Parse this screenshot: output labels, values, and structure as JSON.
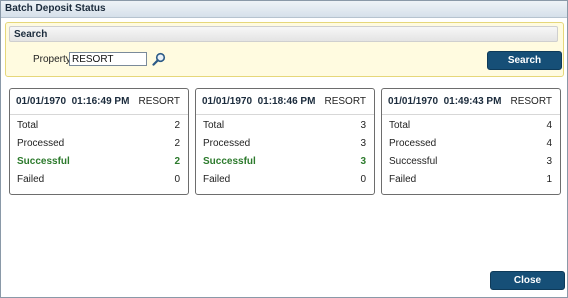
{
  "window": {
    "title": "Batch Deposit Status"
  },
  "search": {
    "header": "Search",
    "property_label": "Property",
    "property_value": "RESORT",
    "lookup_icon": "magnifier-icon",
    "button_label": "Search"
  },
  "cards": [
    {
      "timestamp": "01/01/1970  01:16:49 PM",
      "property": "RESORT",
      "rows": [
        {
          "label": "Total",
          "value": "2",
          "highlight": false
        },
        {
          "label": "Processed",
          "value": "2",
          "highlight": false
        },
        {
          "label": "Successful",
          "value": "2",
          "highlight": true
        },
        {
          "label": "Failed",
          "value": "0",
          "highlight": false
        }
      ]
    },
    {
      "timestamp": "01/01/1970  01:18:46 PM",
      "property": "RESORT",
      "rows": [
        {
          "label": "Total",
          "value": "3",
          "highlight": false
        },
        {
          "label": "Processed",
          "value": "3",
          "highlight": false
        },
        {
          "label": "Successful",
          "value": "3",
          "highlight": true
        },
        {
          "label": "Failed",
          "value": "0",
          "highlight": false
        }
      ]
    },
    {
      "timestamp": "01/01/1970  01:49:43 PM",
      "property": "RESORT",
      "rows": [
        {
          "label": "Total",
          "value": "4",
          "highlight": false
        },
        {
          "label": "Processed",
          "value": "4",
          "highlight": false
        },
        {
          "label": "Successful",
          "value": "3",
          "highlight": false
        },
        {
          "label": "Failed",
          "value": "1",
          "highlight": false
        }
      ]
    }
  ],
  "footer": {
    "close_label": "Close"
  },
  "colors": {
    "button": "#164f77",
    "success": "#2c7a2c",
    "panel_bg": "#fffbe0"
  }
}
